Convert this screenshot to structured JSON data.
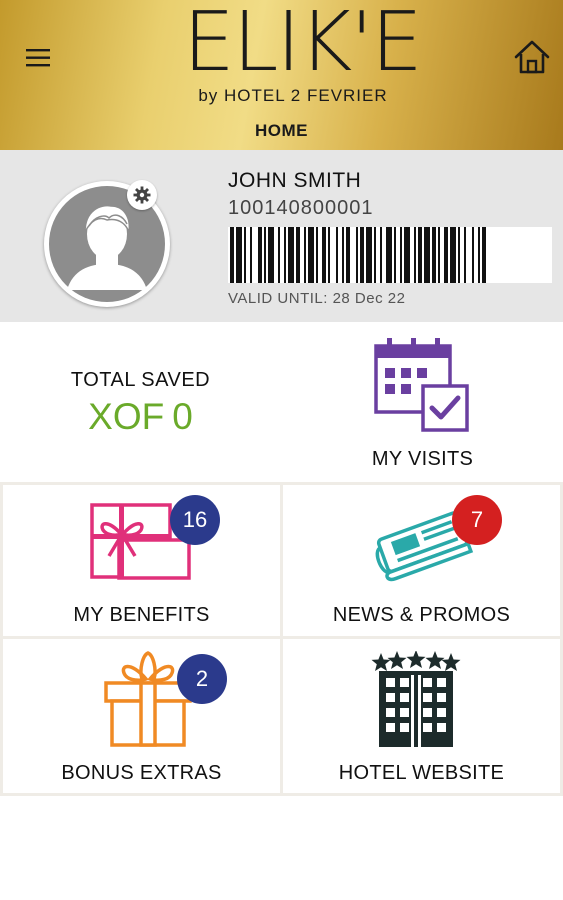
{
  "header": {
    "logo_main": "ELIK'E",
    "logo_sub": "by HOTEL 2 FEVRIER",
    "page_title": "HOME",
    "menu_icon": "hamburger-menu-icon",
    "home_icon": "home-icon"
  },
  "profile": {
    "name": "JOHN SMITH",
    "member_number": "100140800001",
    "valid_until": "VALID UNTIL: 28 Dec 22",
    "avatar_icon": "user-avatar-icon",
    "settings_icon": "gear-icon"
  },
  "savings": {
    "label": "TOTAL SAVED",
    "currency": "XOF",
    "amount": "0"
  },
  "tiles": {
    "visits": {
      "label": "MY VISITS",
      "icon": "calendar-check-icon"
    },
    "benefits": {
      "label": "MY BENEFITS",
      "icon": "gift-card-icon",
      "badge": "16"
    },
    "news": {
      "label": "NEWS & PROMOS",
      "icon": "newspaper-icon",
      "badge": "7"
    },
    "bonus": {
      "label": "BONUS EXTRAS",
      "icon": "gift-box-icon",
      "badge": "2"
    },
    "website": {
      "label": "HOTEL WEBSITE",
      "icon": "hotel-building-icon"
    }
  },
  "colors": {
    "gold": "#d8b14b",
    "green": "#6aaa2a",
    "navy_badge": "#2b3a8c",
    "red_badge": "#d42020",
    "purple": "#6a3fa0",
    "pink": "#e0307a",
    "teal": "#2aa9a9",
    "orange": "#f08a24"
  }
}
